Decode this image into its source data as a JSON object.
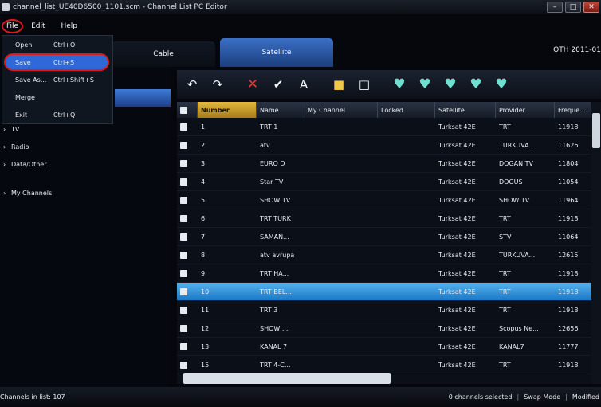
{
  "window": {
    "title": "channel_list_UE40D6500_1101.scm - Channel List PC Editor",
    "minimize": "–",
    "maximize": "□",
    "close": "✕"
  },
  "menu": {
    "file": "File",
    "edit": "Edit",
    "help": "Help"
  },
  "file_menu": [
    {
      "label": "Open",
      "shortcut": "Ctrl+O"
    },
    {
      "label": "Save",
      "shortcut": "Ctrl+S"
    },
    {
      "label": "Save As...",
      "shortcut": "Ctrl+Shift+S"
    },
    {
      "label": "Merge",
      "shortcut": ""
    },
    {
      "label": "Exit",
      "shortcut": "Ctrl+Q"
    }
  ],
  "tabs": {
    "cable": "Cable",
    "satellite": "Satellite"
  },
  "oth_label": "OTH  2011-01",
  "tree": {
    "tv": "TV",
    "radio": "Radio",
    "data_other": "Data/Other",
    "my_channels": "My Channels"
  },
  "columns": {
    "number": "Number",
    "name": "Name",
    "my_channel": "My Channel",
    "locked": "Locked",
    "satellite": "Satellite",
    "provider": "Provider",
    "frequency": "Freque..."
  },
  "channels": [
    {
      "number": "1",
      "name": "TRT 1",
      "satellite": "Turksat 42E",
      "provider": "TRT",
      "frequency": "11918"
    },
    {
      "number": "2",
      "name": "atv",
      "satellite": "Turksat 42E",
      "provider": "TURKUVA...",
      "frequency": "11626"
    },
    {
      "number": "3",
      "name": "EURO D",
      "satellite": "Turksat 42E",
      "provider": "DOGAN TV",
      "frequency": "11804"
    },
    {
      "number": "4",
      "name": "Star TV",
      "satellite": "Turksat 42E",
      "provider": "DOGUS",
      "frequency": "11054"
    },
    {
      "number": "5",
      "name": "SHOW TV",
      "satellite": "Turksat 42E",
      "provider": "SHOW TV",
      "frequency": "11964"
    },
    {
      "number": "6",
      "name": "TRT TURK",
      "satellite": "Turksat 42E",
      "provider": "TRT",
      "frequency": "11918"
    },
    {
      "number": "7",
      "name": "SAMAN...",
      "satellite": "Turksat 42E",
      "provider": "STV",
      "frequency": "11064"
    },
    {
      "number": "8",
      "name": "atv avrupa",
      "satellite": "Turksat 42E",
      "provider": "TURKUVA...",
      "frequency": "12615"
    },
    {
      "number": "9",
      "name": "TRT HA...",
      "satellite": "Turksat 42E",
      "provider": "TRT",
      "frequency": "11918"
    },
    {
      "number": "10",
      "name": "TRT BEL...",
      "satellite": "Turksat 42E",
      "provider": "TRT",
      "frequency": "11918"
    },
    {
      "number": "11",
      "name": "TRT 3",
      "satellite": "Turksat 42E",
      "provider": "TRT",
      "frequency": "11918"
    },
    {
      "number": "12",
      "name": "SHOW ...",
      "satellite": "Turksat 42E",
      "provider": "Scopus Ne...",
      "frequency": "12656"
    },
    {
      "number": "13",
      "name": "KANAL 7",
      "satellite": "Turksat 42E",
      "provider": "KANAL7",
      "frequency": "11777"
    },
    {
      "number": "15",
      "name": "TRT 4-C...",
      "satellite": "Turksat 42E",
      "provider": "TRT",
      "frequency": "11918"
    }
  ],
  "status": {
    "channels_in_list": "Channels in list: 107",
    "selected": "0 channels selected",
    "mode": "Swap Mode",
    "modified": "Modified"
  }
}
